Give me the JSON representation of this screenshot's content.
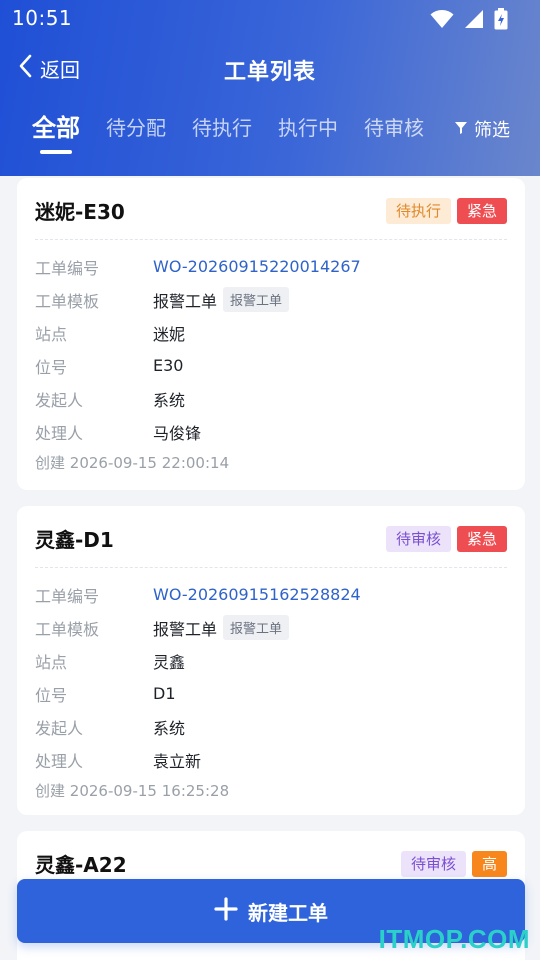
{
  "status_bar": {
    "time": "10:51",
    "icons": [
      "wifi-icon",
      "signal-icon",
      "battery-charging-icon"
    ]
  },
  "nav": {
    "back_label": "返回",
    "title": "工单列表"
  },
  "tabs": [
    {
      "label": "全部",
      "active": true
    },
    {
      "label": "待分配",
      "active": false
    },
    {
      "label": "待执行",
      "active": false
    },
    {
      "label": "执行中",
      "active": false
    },
    {
      "label": "待审核",
      "active": false
    }
  ],
  "filter_label": "筛选",
  "field_labels": {
    "order_no": "工单编号",
    "template": "工单模板",
    "site": "站点",
    "position": "位号",
    "initiator": "发起人",
    "handler": "处理人",
    "created_prefix": "创建"
  },
  "orders": [
    {
      "title": "迷妮-E30",
      "status": "待执行",
      "priority": "紧急",
      "order_no": "WO-20260915220014267",
      "template": "报警工单",
      "template_tag": "报警工单",
      "site": "迷妮",
      "position": "E30",
      "initiator": "系统",
      "handler": "马俊锋",
      "created": "2026-09-15 22:00:14"
    },
    {
      "title": "灵鑫-D1",
      "status": "待审核",
      "priority": "紧急",
      "order_no": "WO-20260915162528824",
      "template": "报警工单",
      "template_tag": "报警工单",
      "site": "灵鑫",
      "position": "D1",
      "initiator": "系统",
      "handler": "袁立新",
      "created": "2026-09-15 16:25:28"
    },
    {
      "title": "灵鑫-A22",
      "status": "待审核",
      "priority": "高"
    }
  ],
  "new_button_label": "新建工单",
  "watermark": "ITMOP.COM",
  "colors": {
    "header_start": "#1f4fd6",
    "header_end": "#6a86cc",
    "primary": "#2e63dc",
    "urgent": "#ee4d52",
    "high": "#f7871c",
    "link": "#2f63c9"
  }
}
